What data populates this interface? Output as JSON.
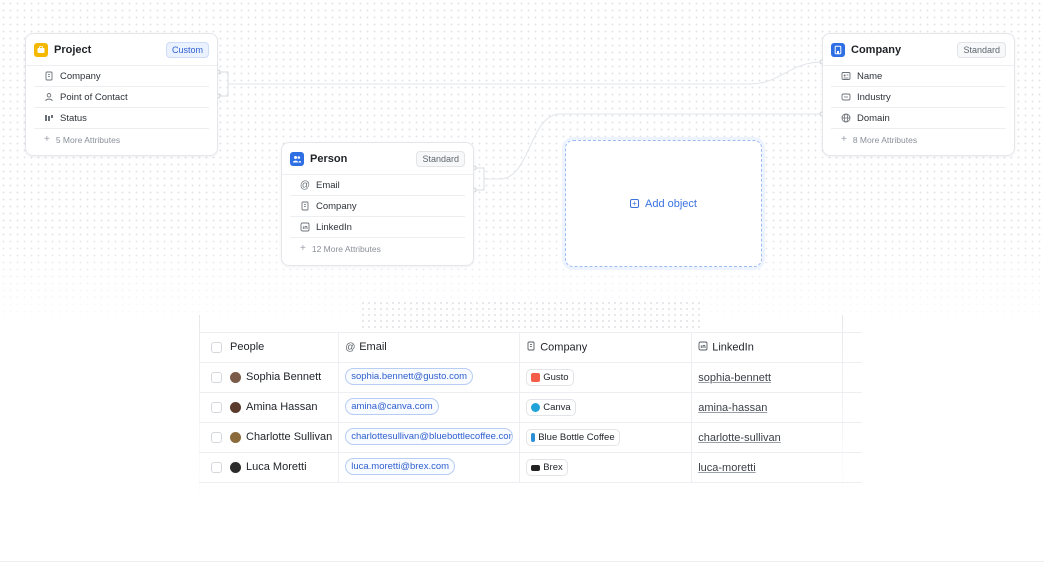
{
  "cards": {
    "project": {
      "title": "Project",
      "badge": "Custom",
      "icon": "briefcase-icon",
      "icon_color": "#f5b800",
      "attributes": [
        {
          "label": "Company",
          "icon": "building-icon"
        },
        {
          "label": "Point of Contact",
          "icon": "user-icon"
        },
        {
          "label": "Status",
          "icon": "status-icon"
        }
      ],
      "more": "5 More Attributes"
    },
    "person": {
      "title": "Person",
      "badge": "Standard",
      "icon": "people-icon",
      "icon_color": "#2f6fe4",
      "attributes": [
        {
          "label": "Email",
          "icon": "at-icon"
        },
        {
          "label": "Company",
          "icon": "building-icon"
        },
        {
          "label": "LinkedIn",
          "icon": "linkedin-icon"
        }
      ],
      "more": "12 More Attributes"
    },
    "company": {
      "title": "Company",
      "badge": "Standard",
      "icon": "building-icon",
      "icon_color": "#2f6fe4",
      "attributes": [
        {
          "label": "Name",
          "icon": "id-card-icon"
        },
        {
          "label": "Industry",
          "icon": "tag-icon"
        },
        {
          "label": "Domain",
          "icon": "globe-icon"
        }
      ],
      "more": "8 More Attributes"
    }
  },
  "add_object": {
    "label": "Add object"
  },
  "table": {
    "headers": {
      "people": "People",
      "email": "Email",
      "company": "Company",
      "linkedin": "LinkedIn"
    },
    "rows": [
      {
        "name": "Sophia Bennett",
        "email": "sophia.bennett@gusto.com",
        "company": "Gusto",
        "company_color": "#f45d48",
        "linkedin": "sophia-bennett",
        "avatar_color": "#7a5a48"
      },
      {
        "name": "Amina Hassan",
        "email": "amina@canva.com",
        "company": "Canva",
        "company_color": "#1fa3d9",
        "linkedin": "amina-hassan",
        "avatar_color": "#5b3a2e"
      },
      {
        "name": "Charlotte Sullivan",
        "email": "charlottesullivan@bluebottlecoffee.com",
        "company": "Blue Bottle Coffee",
        "company_color": "#2a8fd6",
        "linkedin": "charlotte-sullivan",
        "avatar_color": "#8a6a3a"
      },
      {
        "name": "Luca Moretti",
        "email": "luca.moretti@brex.com",
        "company": "Brex",
        "company_color": "#222222",
        "linkedin": "luca-moretti",
        "avatar_color": "#2b2b2b"
      }
    ]
  },
  "colors": {
    "accent": "#3a72e0",
    "custom_badge": "#2f5fcf"
  }
}
